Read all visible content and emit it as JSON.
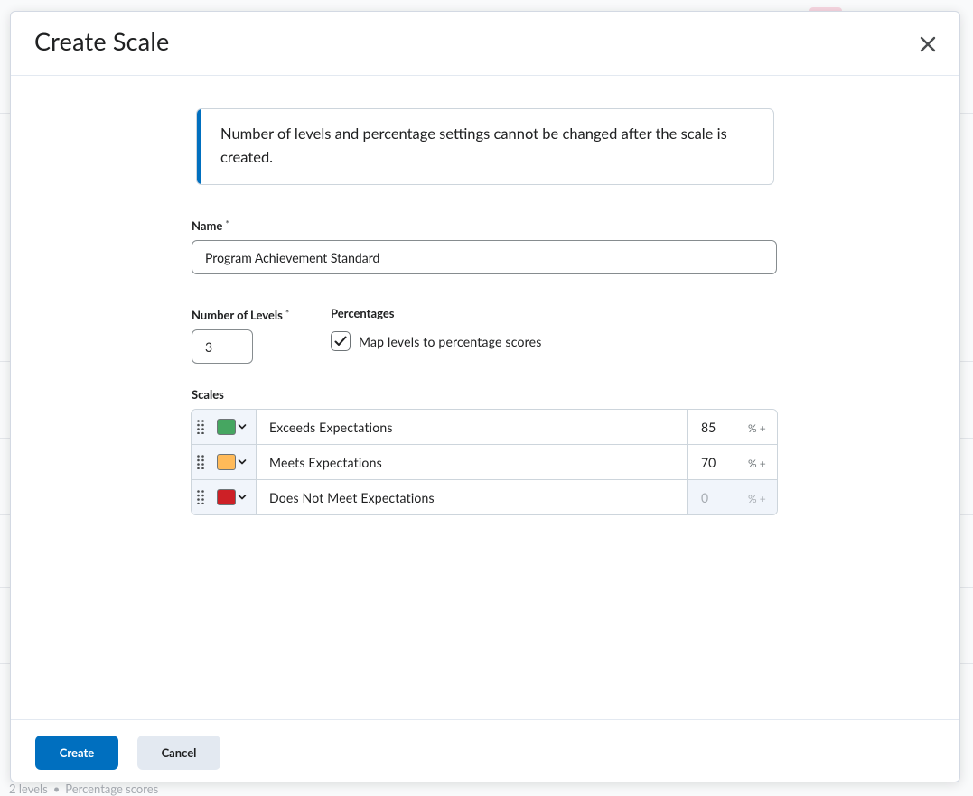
{
  "background": {
    "footer_levels": "2 levels",
    "footer_percent": "Percentage scores"
  },
  "dialog": {
    "title": "Create Scale",
    "close_icon": "close-icon",
    "alert_text": "Number of levels and percentage settings cannot be changed after the scale is created.",
    "name_label": "Name",
    "required_mark": "*",
    "name_value": "Program Achievement Standard",
    "levels_label": "Number of Levels",
    "levels_value": "3",
    "percentages_label": "Percentages",
    "map_checkbox_label": "Map levels to percentage scores",
    "map_checked": true,
    "scales_label": "Scales",
    "scales": [
      {
        "name": "Exceeds Expectations",
        "color": "#46a661",
        "percent": "85",
        "suffix": "% +",
        "disabled": false
      },
      {
        "name": "Meets Expectations",
        "color": "#ffba59",
        "percent": "70",
        "suffix": "% +",
        "disabled": false
      },
      {
        "name": "Does Not Meet Expectations",
        "color": "#cd2026",
        "percent": "0",
        "suffix": "% +",
        "disabled": true
      }
    ],
    "create_label": "Create",
    "cancel_label": "Cancel"
  },
  "colors": {
    "primary": "#006fbf",
    "alert_accent": "#006fbf",
    "secondary_button": "#e3e9f1"
  }
}
